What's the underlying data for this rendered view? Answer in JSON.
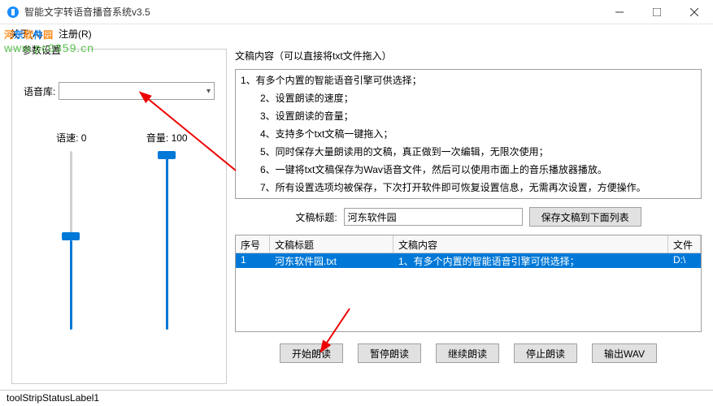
{
  "window": {
    "title": "智能文字转语音播音系统v3.5"
  },
  "menu": {
    "about": "关于(A)",
    "register": "注册(R)"
  },
  "watermark": {
    "brand": "河东软件园",
    "url": "www.pc0359.cn"
  },
  "left": {
    "title": "参数设置",
    "voice_label": "语音库:",
    "speed_label": "语速:",
    "speed_value": "0",
    "volume_label": "音量:",
    "volume_value": "100"
  },
  "right": {
    "content_label": "文稿内容（可以直接将txt文件拖入）",
    "lines": [
      "1、有多个内置的智能语音引擎可供选择；",
      "2、设置朗读的速度；",
      "3、设置朗读的音量；",
      "4、支持多个txt文稿一键拖入；",
      "5、同时保存大量朗读用的文稿，真正做到一次编辑，无限次使用；",
      "6、一键将txt文稿保存为Wav语音文件，然后可以使用市面上的音乐播放器播放。",
      "7、所有设置选项均被保存，下次打开软件即可恢复设置信息，无需再次设置，方便操作。"
    ],
    "title_label": "文稿标题:",
    "title_value": "河东软件园",
    "save_btn": "保存文稿到下面列表"
  },
  "table": {
    "headers": [
      "序号",
      "文稿标题",
      "文稿内容",
      "文件"
    ],
    "rows": [
      {
        "no": "1",
        "title": "河东软件园.txt",
        "content": "1、有多个内置的智能语音引擎可供选择；",
        "path": "D:\\"
      }
    ]
  },
  "buttons": {
    "start": "开始朗读",
    "pause": "暂停朗读",
    "continue": "继续朗读",
    "stop": "停止朗读",
    "export": "输出WAV"
  },
  "status": "toolStripStatusLabel1"
}
